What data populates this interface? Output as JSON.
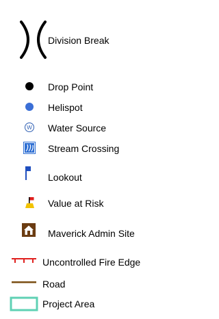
{
  "legend": {
    "items": [
      {
        "key": "division_break",
        "label": "Division Break",
        "icon": "division-break-icon"
      },
      {
        "key": "drop_point",
        "label": "Drop Point",
        "icon": "black-dot-icon",
        "color": "#000000"
      },
      {
        "key": "helispot",
        "label": "Helispot",
        "icon": "blue-dot-icon",
        "color": "#3b6fd6"
      },
      {
        "key": "water_source",
        "label": "Water Source",
        "icon": "circled-w-icon",
        "color": "#2f5fb3"
      },
      {
        "key": "stream_crossing",
        "label": "Stream Crossing",
        "icon": "stream-crossing-icon",
        "color": "#2e6fd3"
      },
      {
        "key": "lookout",
        "label": "Lookout",
        "icon": "blue-flag-icon",
        "color": "#1f4fbf"
      },
      {
        "key": "value_at_risk",
        "label": "Value at Risk",
        "icon": "value-at-risk-icon",
        "color": "#f2c200"
      },
      {
        "key": "maverick_admin_site",
        "label": "Maverick Admin Site",
        "icon": "admin-building-icon",
        "color": "#6b3c12"
      },
      {
        "key": "uncontrolled_fire_edge",
        "label": "Uncontrolled Fire Edge",
        "icon": "red-hatched-line-icon",
        "color": "#e0201e"
      },
      {
        "key": "road",
        "label": "Road",
        "icon": "brown-line-icon",
        "color": "#7a4e12"
      },
      {
        "key": "project_area",
        "label": "Project Area",
        "icon": "teal-rectangle-icon",
        "color": "#5fd1b4"
      }
    ]
  }
}
